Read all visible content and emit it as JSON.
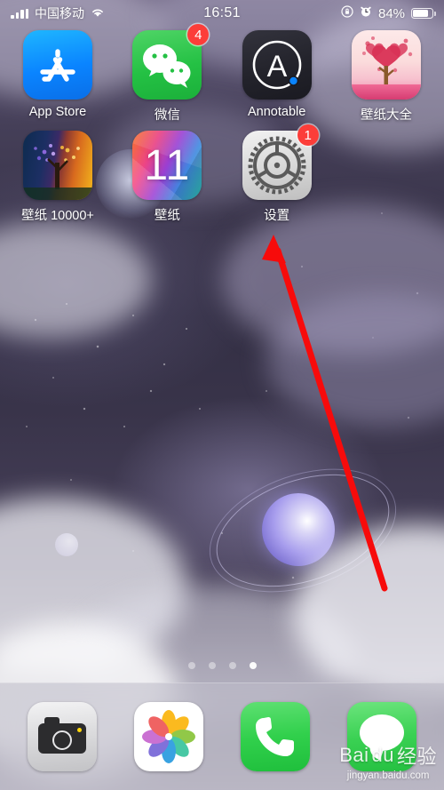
{
  "status_bar": {
    "carrier": "中国移动",
    "time": "16:51",
    "battery_percent": "84%",
    "signal_icon": "cellular-signal-icon",
    "wifi_icon": "wifi-icon",
    "rotation_lock_icon": "rotation-lock-icon",
    "alarm_icon": "alarm-clock-icon",
    "battery_icon": "battery-icon"
  },
  "home_screen": {
    "rows": [
      {
        "apps": [
          {
            "label": "App Store",
            "icon": "app-store-icon",
            "badge": ""
          },
          {
            "label": "微信",
            "icon": "wechat-icon",
            "badge": "4"
          },
          {
            "label": "Annotable",
            "icon": "annotable-icon",
            "badge": ""
          },
          {
            "label": "壁纸大全",
            "icon": "wallpaper-daquan-icon",
            "badge": ""
          }
        ]
      },
      {
        "apps": [
          {
            "label": "壁纸 10000+",
            "icon": "wallpaper-10000-icon",
            "badge": ""
          },
          {
            "label": "壁纸",
            "icon": "wallpaper-11-icon",
            "badge": "",
            "icon_text": "11"
          },
          {
            "label": "设置",
            "icon": "settings-gear-icon",
            "badge": "1"
          }
        ]
      }
    ],
    "page_dots": {
      "count": 4,
      "active_index": 3
    }
  },
  "dock": {
    "apps": [
      {
        "label": "",
        "icon": "camera-icon"
      },
      {
        "label": "",
        "icon": "photos-icon"
      },
      {
        "label": "",
        "icon": "phone-icon"
      },
      {
        "label": "",
        "icon": "messages-icon"
      }
    ]
  },
  "annotation": {
    "arrow_color": "#f70b0b",
    "arrow_name": "red-pointer-arrow",
    "points_to": "设置"
  },
  "watermark": {
    "brand_primary": "Bai",
    "brand_secondary": "du",
    "brand_cn": "经验",
    "url": "jingyan.baidu.com"
  },
  "colors": {
    "badge_red": "#fc3d39",
    "appstore_blue": "#0a84ff",
    "wechat_green": "#24c144",
    "arrow_red": "#f70b0b"
  }
}
